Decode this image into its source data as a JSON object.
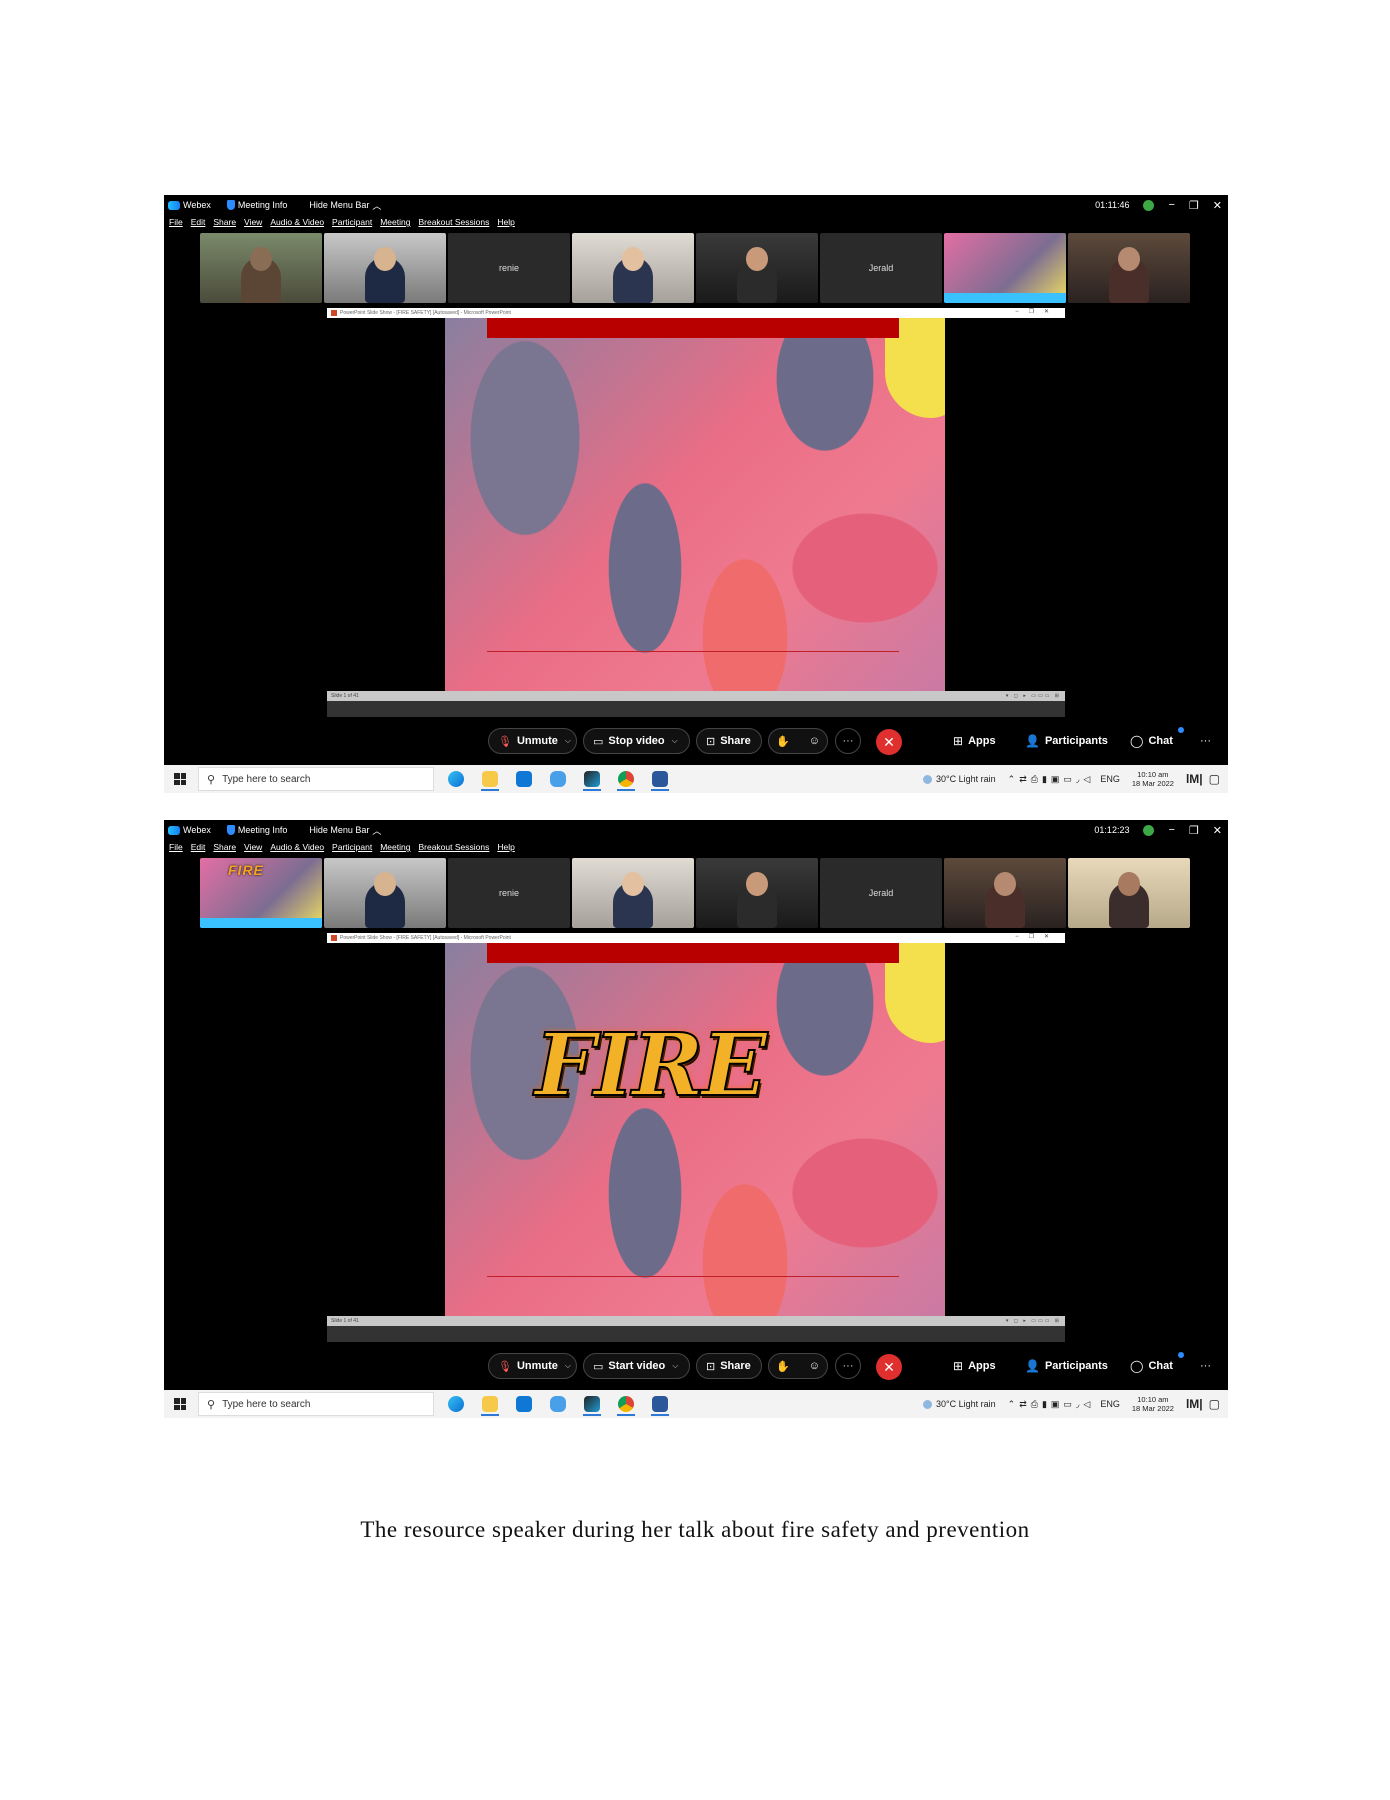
{
  "screenshots": [
    {
      "app_name": "Webex",
      "meeting_info": "Meeting Info",
      "hide_menu": "Hide Menu Bar",
      "time": "01:11:46",
      "menu": [
        "File",
        "Edit",
        "Share",
        "View",
        "Audio & Video",
        "Participant",
        "Meeting",
        "Breakout Sessions",
        "Help"
      ],
      "participants": [
        {
          "name": "",
          "type": "cam"
        },
        {
          "name": "",
          "type": "cam2"
        },
        {
          "name": "renie",
          "type": "noname"
        },
        {
          "name": "",
          "type": "cam3"
        },
        {
          "name": "",
          "type": "cam4"
        },
        {
          "name": "Jerald",
          "type": "noname"
        },
        {
          "name": "",
          "type": "slide"
        },
        {
          "name": "",
          "type": "cam5"
        }
      ],
      "ppt_title": "PowerPoint Slide Show - [FIRE SAFETY] [Autosaved] - Microsoft PowerPoint",
      "slide_status": "Slide 1 of 41",
      "slide_text": "",
      "controls": {
        "unmute": "Unmute",
        "video": "Stop video",
        "share": "Share",
        "apps": "Apps",
        "participants": "Participants",
        "chat": "Chat"
      },
      "taskbar": {
        "search": "Type here to search",
        "weather": "30°C  Light rain",
        "lang": "ENG",
        "time": "10:10 am",
        "date": "18 Mar 2022"
      }
    },
    {
      "app_name": "Webex",
      "meeting_info": "Meeting Info",
      "hide_menu": "Hide Menu Bar",
      "time": "01:12:23",
      "menu": [
        "File",
        "Edit",
        "Share",
        "View",
        "Audio & Video",
        "Participant",
        "Meeting",
        "Breakout Sessions",
        "Help"
      ],
      "participants": [
        {
          "name": "",
          "type": "slide"
        },
        {
          "name": "",
          "type": "cam2"
        },
        {
          "name": "renie",
          "type": "noname"
        },
        {
          "name": "",
          "type": "cam3"
        },
        {
          "name": "",
          "type": "cam4"
        },
        {
          "name": "Jerald",
          "type": "noname"
        },
        {
          "name": "",
          "type": "cam5"
        },
        {
          "name": "",
          "type": "cam6"
        }
      ],
      "ppt_title": "PowerPoint Slide Show - [FIRE SAFETY] [Autosaved] - Microsoft PowerPoint",
      "slide_status": "Slide 1 of 41",
      "slide_text": "FIRE",
      "controls": {
        "unmute": "Unmute",
        "video": "Start video",
        "share": "Share",
        "apps": "Apps",
        "participants": "Participants",
        "chat": "Chat"
      },
      "taskbar": {
        "search": "Type here to search",
        "weather": "30°C  Light rain",
        "lang": "ENG",
        "time": "10:10 am",
        "date": "18 Mar 2022"
      }
    }
  ],
  "thumbnail_fire_text": "FIRE",
  "caption": "The resource speaker during her talk about fire safety and prevention",
  "colors": {
    "accent": "#2d8cff",
    "end_call": "#e02f2f",
    "slide_bar": "#b80000",
    "fire": "#f2b126"
  }
}
